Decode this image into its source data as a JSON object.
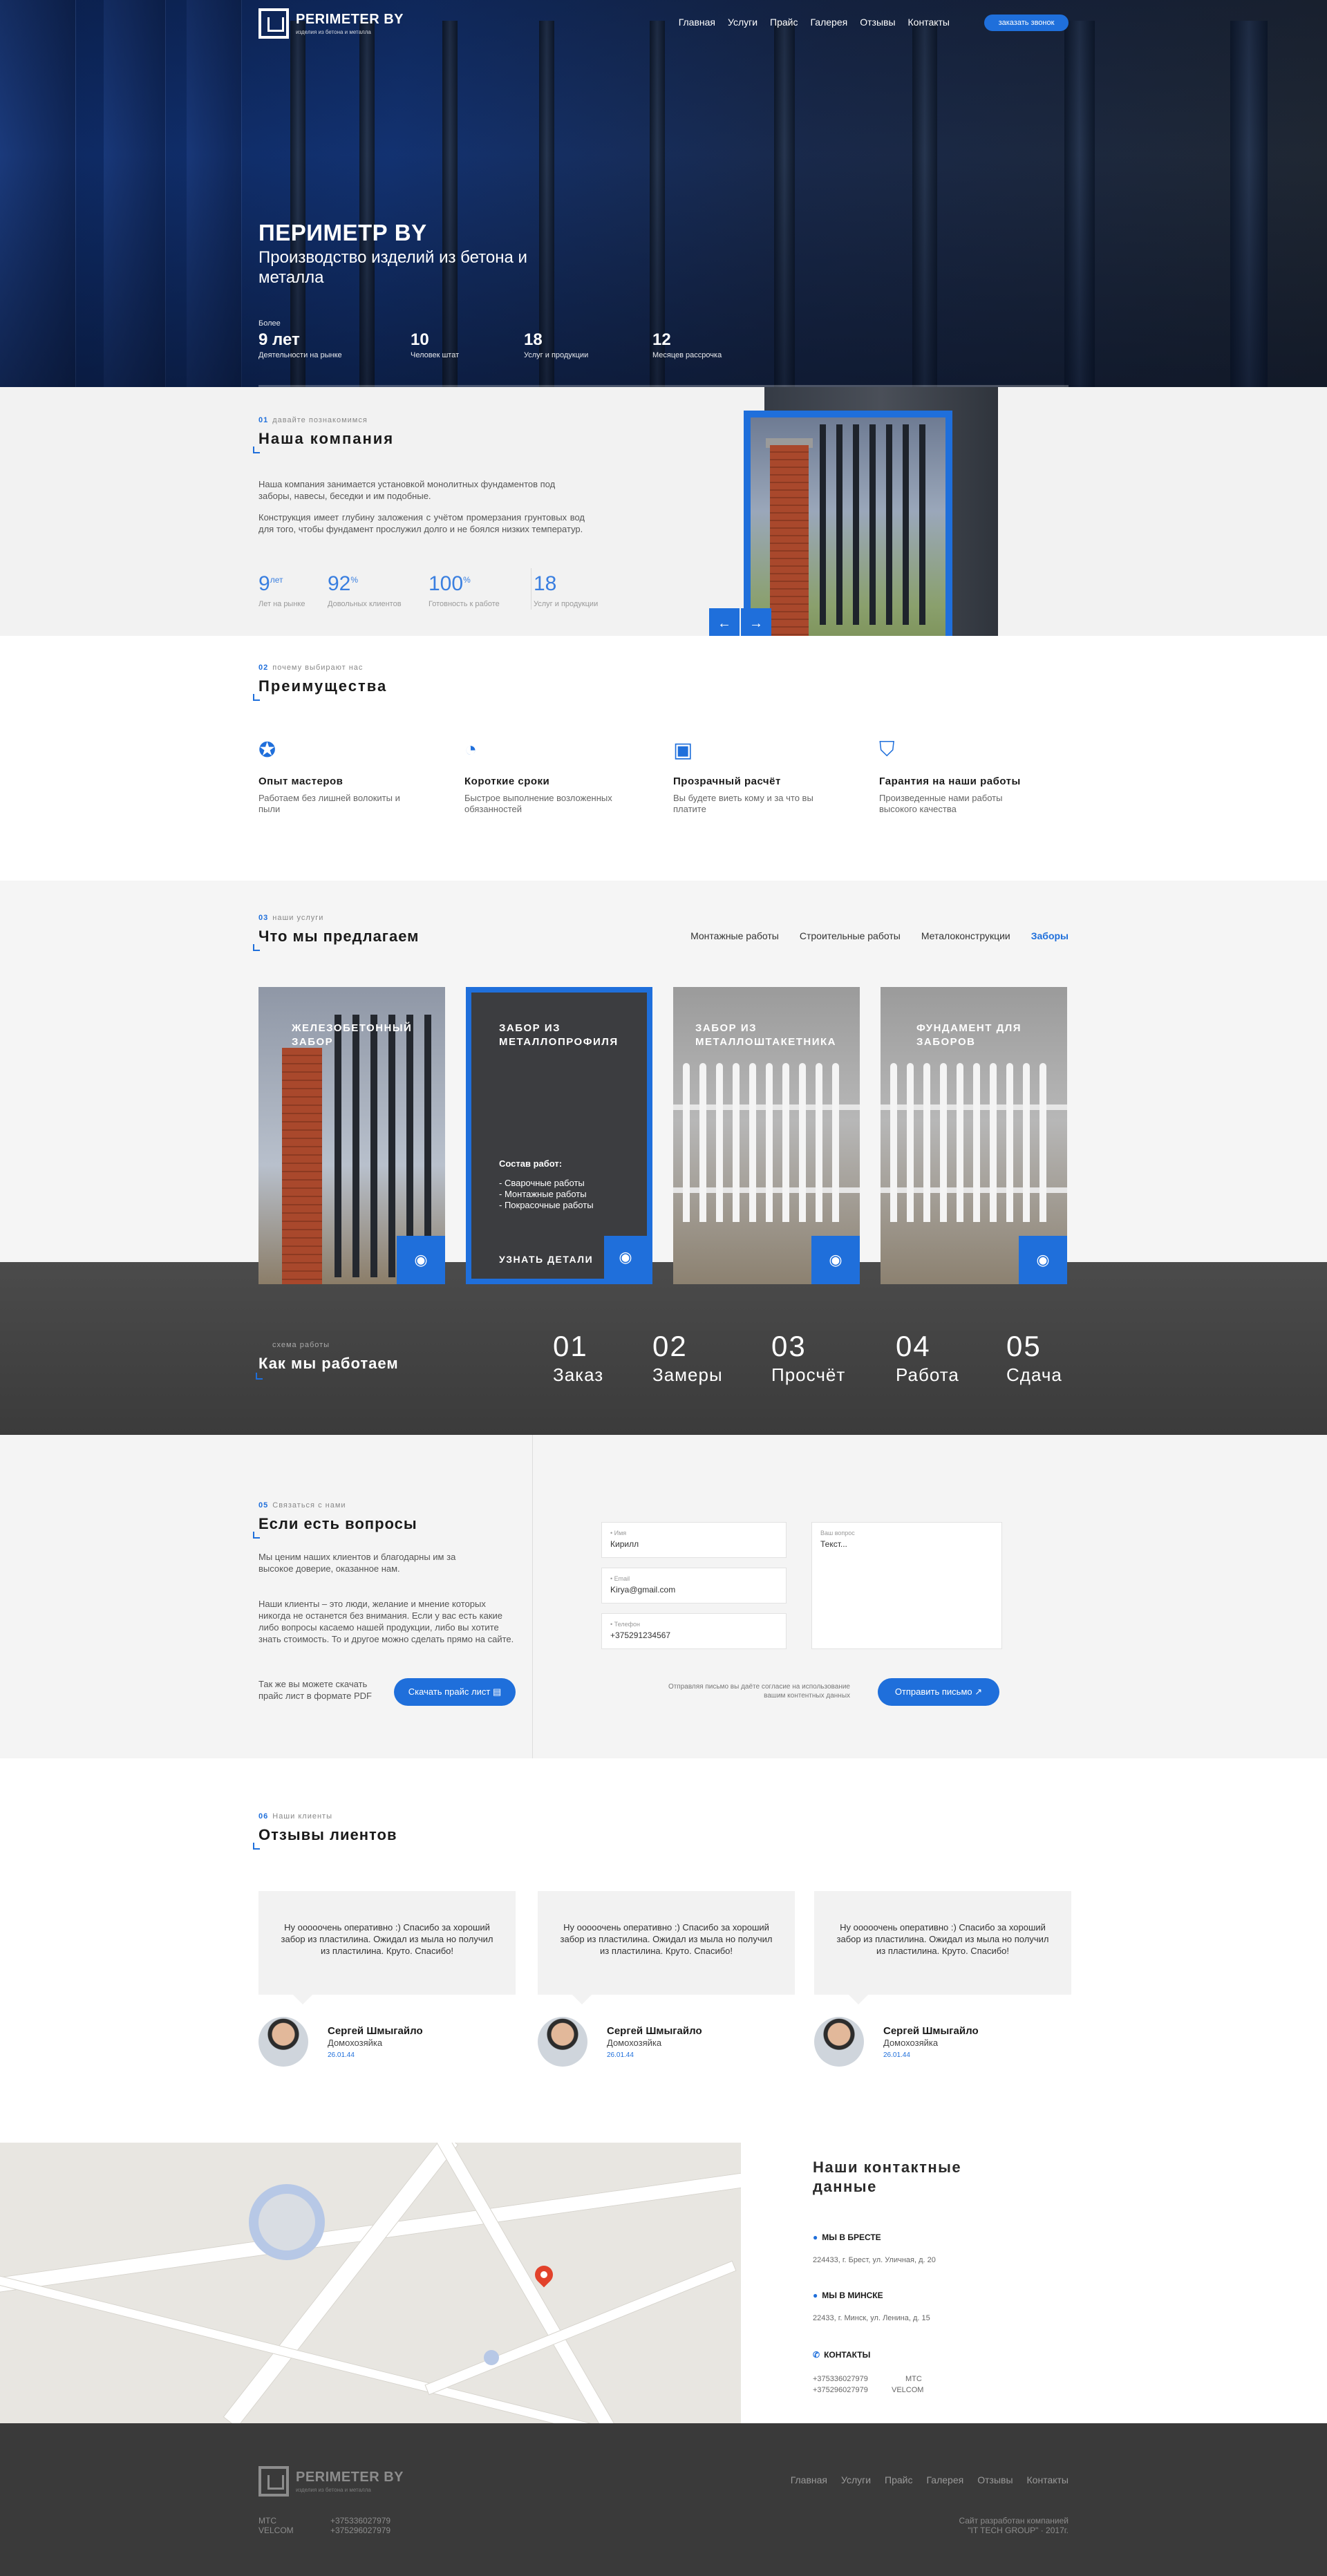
{
  "header": {
    "logo_title": "PERIMETER BY",
    "logo_sub": "изделия из бетона и металла",
    "nav": [
      "Главная",
      "Услуги",
      "Прайс",
      "Галерея",
      "Отзывы",
      "Контакты"
    ],
    "call_button": "заказать звонок"
  },
  "hero": {
    "title": "ПЕРИМЕТР BY",
    "subtitle": "Производство изделий из бетона и металла",
    "stats": [
      {
        "pre": "Более",
        "num": "9 лет",
        "label": "Деятельности на рынке"
      },
      {
        "pre": "",
        "num": "10",
        "label": "Человек штат"
      },
      {
        "pre": "",
        "num": "18",
        "label": "Услуг и продукции"
      },
      {
        "pre": "",
        "num": "12",
        "label": "Месяцев рассрочка"
      }
    ]
  },
  "company": {
    "num": "01",
    "kicker": "давайте познакомимся",
    "title": "Наша компания",
    "p1": "Наша компания занимается установкой монолитных фундаментов под заборы, навесы, беседки и им подобные.",
    "p2": "Конструкция имеет глубину заложения с учётом промерзания грунтовых вод для того, чтобы фундамент прослужил долго и не боялся низких температур.",
    "stats": [
      {
        "num": "9",
        "sup": "лет",
        "label": "Лет на рынке"
      },
      {
        "num": "92",
        "sup": "%",
        "label": "Довольных клиентов"
      },
      {
        "num": "100",
        "sup": "%",
        "label": "Готовность к работе"
      },
      {
        "num": "18",
        "sup": "",
        "label": "Услуг и продукции"
      }
    ],
    "prev": "←",
    "next": "→"
  },
  "advantages": {
    "num": "02",
    "kicker": "почему выбирают нас",
    "title": "Преимущества",
    "items": [
      {
        "icon": "award-icon",
        "glyph": "✪",
        "title": "Опыт мастеров",
        "desc": "Работаем без лишней волокиты и пыли"
      },
      {
        "icon": "clock-icon",
        "glyph": "◔",
        "title": "Короткие сроки",
        "desc": "Быстрое выполнение возложенных обязанностей"
      },
      {
        "icon": "money-icon",
        "glyph": "▣",
        "title": "Прозрачный расчёт",
        "desc": "Вы будете виеть кому и за что вы платите"
      },
      {
        "icon": "shield-icon",
        "glyph": "⛉",
        "title": "Гарантия на наши работы",
        "desc": "Произведенные нами работы высокого качества"
      }
    ]
  },
  "offer": {
    "num": "03",
    "kicker": "наши услуги",
    "title": "Что мы предлагаем",
    "tabs": [
      "Монтажные работы",
      "Строительные работы",
      "Металоконструкции",
      "Заборы"
    ],
    "cards": [
      {
        "title": "ЖЕЛЕЗОБЕТОННЫЙ ЗАБОР"
      },
      {
        "title": "ЗАБОР ИЗ МЕТАЛЛОПРОФИЛЯ",
        "comp_title": "Состав работ:",
        "comp": [
          "- Сварочные работы",
          "- Монтажные работы",
          "- Покрасочные работы"
        ],
        "more": "УЗНАТЬ ДЕТАЛИ"
      },
      {
        "title": "ЗАБОР ИЗ МЕТАЛЛОШТАКЕТНИКА"
      },
      {
        "title": "ФУНДАМЕНТ ДЛЯ ЗАБОРОВ"
      }
    ]
  },
  "process": {
    "kicker": "схема работы",
    "title": "Как мы работаем",
    "steps": [
      {
        "n": "01",
        "l": "Заказ"
      },
      {
        "n": "02",
        "l": "Замеры"
      },
      {
        "n": "03",
        "l": "Просчёт"
      },
      {
        "n": "04",
        "l": "Работа"
      },
      {
        "n": "05",
        "l": "Сдача"
      }
    ]
  },
  "contact": {
    "num": "05",
    "kicker": "Связаться с нами",
    "title": "Если есть вопросы",
    "p1": "Мы ценим наших клиентов и благодарны им за высокое доверие, оказанное нам.",
    "p2": "Наши клиенты – это люди, желание и мнение которых никогда не останется без внимания. Если у вас есть какие либо вопросы касаемо нашей продукции, либо вы хотите знать стоимость. То и другое можно сделать прямо на сайте.",
    "p3": "Так же вы можете скачать прайс лист в формате PDF",
    "price_btn": "Скачать прайс лист",
    "fields": [
      {
        "label": "• Имя",
        "value": "Кирилл"
      },
      {
        "label": "• Email",
        "value": "Kirya@gmail.com"
      },
      {
        "label": "• Телефон",
        "value": "+375291234567"
      }
    ],
    "question_label": "Ваш вопрос",
    "question_value": "Текст...",
    "agree": "Отправляя письмо вы даёте согласие на использование вашим контентных данных",
    "send_btn": "Отправить письмо"
  },
  "reviews": {
    "num": "06",
    "kicker": "Наши клиенты",
    "title": "Отзывы лиентов",
    "items": [
      {
        "text": "Ну ооооочень оперативно :) Спасибо за хороший забор из пластилина. Ожидал из мыла но получил из пластилина. Круто. Спасибо!",
        "name": "Сергей Шмыгайло",
        "role": "Домохозяйка",
        "date": "26.01.44"
      },
      {
        "text": "Ну ооооочень оперативно :) Спасибо за хороший забор из пластилина. Ожидал из мыла но получил из пластилина. Круто. Спасибо!",
        "name": "Сергей Шмыгайло",
        "role": "Домохозяйка",
        "date": "26.01.44"
      },
      {
        "text": "Ну ооооочень оперативно :) Спасибо за хороший забор из пластилина. Ожидал из мыла но получил из пластилина. Круто. Спасибо!",
        "name": "Сергей Шмыгайло",
        "role": "Домохозяйка",
        "date": "26.01.44"
      }
    ]
  },
  "contacts_info": {
    "title": "Наши контактные данные",
    "brest_h": "МЫ В БРЕСТЕ",
    "brest_addr": "224433, г. Брест, ул. Уличная, д. 20",
    "minsk_h": "МЫ В МИНСКЕ",
    "minsk_addr": "22433, г. Минск, ул. Ленина, д. 15",
    "contacts_h": "КОНТАКТЫ",
    "phone1": "+375336027979",
    "op1": "МТС",
    "phone2": "+375296027979",
    "op2": "VELCOM"
  },
  "footer": {
    "logo_title": "PERIMETER BY",
    "logo_sub": "изделия из бетона и металла",
    "nav": [
      "Главная",
      "Услуги",
      "Прайс",
      "Галерея",
      "Отзывы",
      "Контакты"
    ],
    "op1": "МТС",
    "op2": "VELCOM",
    "phone1": "+375336027979",
    "phone2": "+375296027979",
    "copy1": "Сайт разработан компанией",
    "copy2": "\"IT TECH GROUP\" · 2017г."
  },
  "colors": {
    "accent": "#1f6fdb",
    "dark": "#3a3a3a",
    "light": "#f4f4f4"
  }
}
